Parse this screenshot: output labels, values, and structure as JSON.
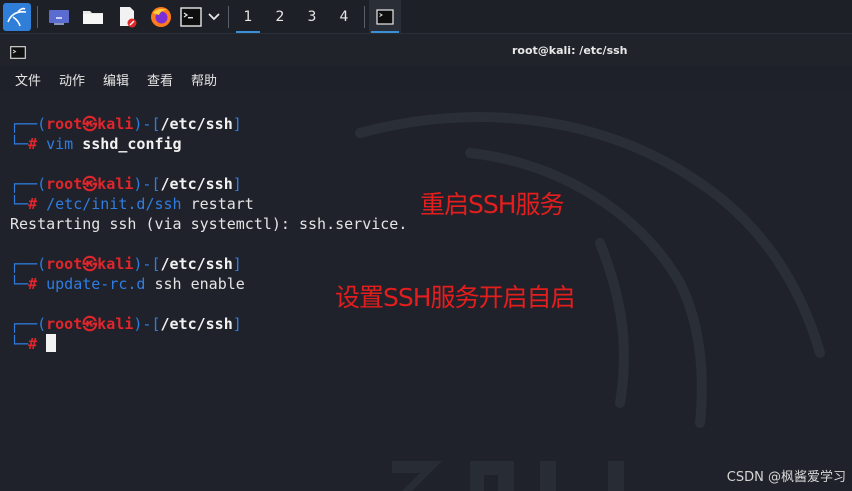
{
  "taskbar": {
    "icons": [
      "kali-menu-icon",
      "desktop-icon",
      "file-manager-icon",
      "text-editor-icon",
      "firefox-icon",
      "terminal-icon",
      "chevron-down-icon"
    ],
    "workspaces": [
      "1",
      "2",
      "3",
      "4"
    ],
    "active_workspace": "1"
  },
  "window": {
    "title": "root@kali: /etc/ssh",
    "menu": [
      "文件",
      "动作",
      "编辑",
      "查看",
      "帮助"
    ]
  },
  "terminal": {
    "prompt": {
      "open": "┌──(",
      "user": "root",
      "skull": "㉿",
      "host": "kali",
      "mid": ")-[",
      "path": "/etc/ssh",
      "close": "]",
      "corner": "└─",
      "hash": "#"
    },
    "blocks": [
      {
        "cmd": "vim",
        "args": "sshd_config",
        "output": ""
      },
      {
        "cmd": "/etc/init.d/ssh",
        "args": "restart",
        "output": "Restarting ssh (via systemctl): ssh.service."
      },
      {
        "cmd": "update-rc.d",
        "args": "ssh enable",
        "output": ""
      },
      {
        "cmd": "",
        "args": "",
        "output": ""
      }
    ]
  },
  "annotations": {
    "restart_note": "重启SSH服务",
    "enable_note": "设置SSH服务开启自启"
  },
  "credit": "CSDN @枫酱爱学习",
  "colors": {
    "prompt_blue": "#2f7de1",
    "prompt_red": "#e0262d",
    "annotation_red": "#e41d1d",
    "background": "#1f222a"
  }
}
